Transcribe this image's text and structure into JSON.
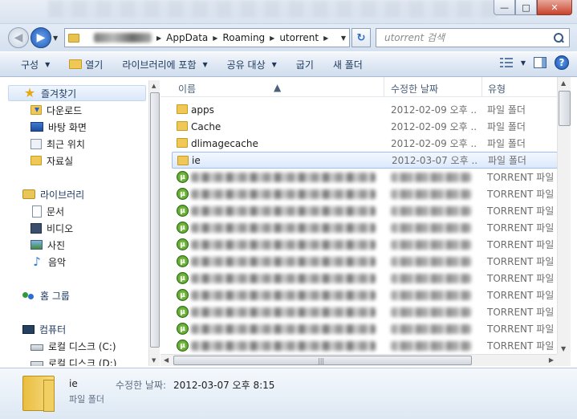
{
  "window": {
    "minimize_label": "—",
    "maximize_label": "□",
    "close_label": "✕"
  },
  "address": {
    "crumbs": [
      "AppData",
      "Roaming",
      "utorrent"
    ],
    "search_placeholder": "utorrent 검색"
  },
  "toolbar": {
    "organize": "구성",
    "open": "열기",
    "include_library": "라이브러리에 포함",
    "share_with": "공유 대상",
    "burn": "굽기",
    "new_folder": "새 폴더",
    "help": "?"
  },
  "navpane": {
    "favorites": "즐겨찾기",
    "downloads": "다운로드",
    "desktop": "바탕 화면",
    "recent": "최근 위치",
    "resources": "자료실",
    "libraries": "라이브러리",
    "documents": "문서",
    "videos": "비디오",
    "pictures": "사진",
    "music": "음악",
    "homegroup": "홈 그룹",
    "computer": "컴퓨터",
    "drive_c": "로컬 디스크 (C:)",
    "drive_d": "로컬 디스크 (D:)"
  },
  "columns": {
    "name": "이름",
    "modified": "수정한 날짜",
    "type": "유형"
  },
  "folders": [
    {
      "name": "apps",
      "date": "2012-02-09 오후 ...",
      "type": "파일 폴더"
    },
    {
      "name": "Cache",
      "date": "2012-02-09 오후 ...",
      "type": "파일 폴더"
    },
    {
      "name": "dlimagecache",
      "date": "2012-02-09 오후 ...",
      "type": "파일 폴더"
    },
    {
      "name": "ie",
      "date": "2012-03-07 오후 ...",
      "type": "파일 폴더"
    }
  ],
  "torrent_type": "TORRENT 파일",
  "details": {
    "name": "ie",
    "type": "파일 폴더",
    "modified_label": "수정한 날짜:",
    "modified_value": "2012-03-07 오후 8:15"
  }
}
